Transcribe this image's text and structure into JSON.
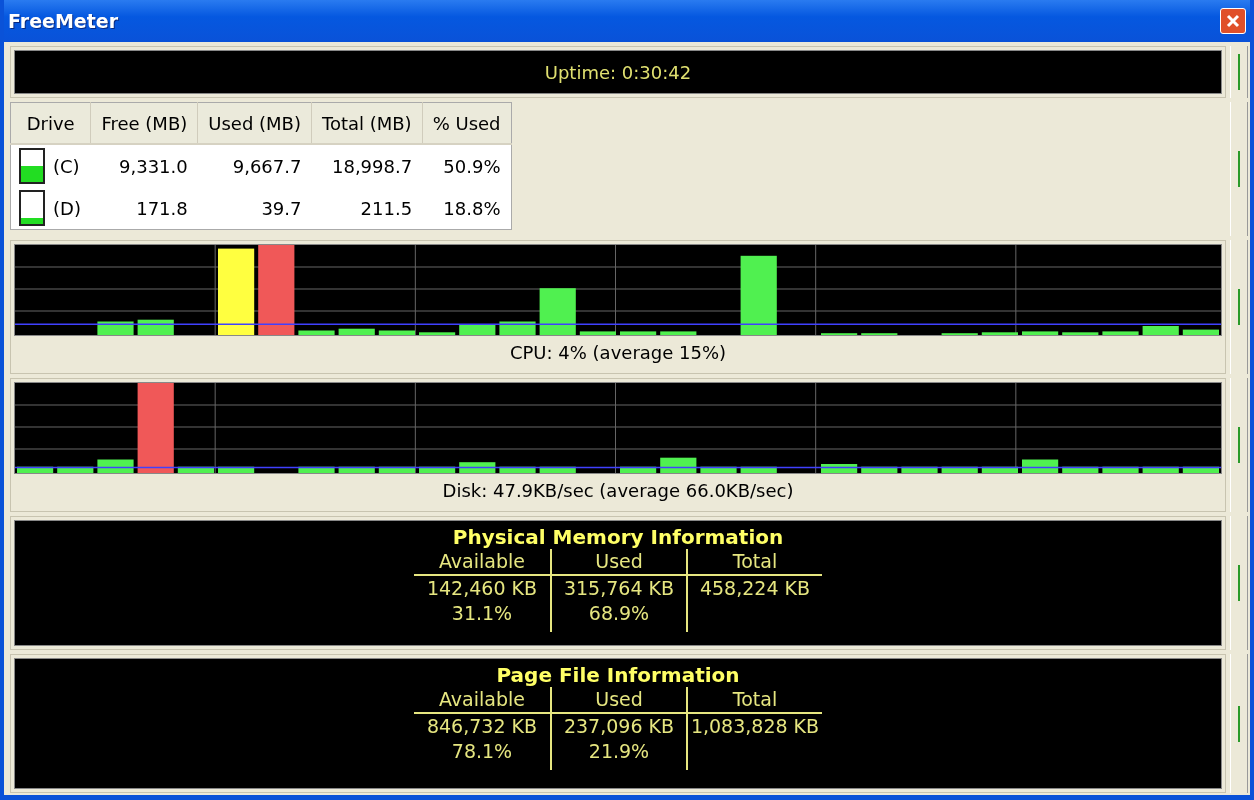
{
  "window": {
    "title": "FreeMeter"
  },
  "uptime": "Uptime: 0:30:42",
  "drives": {
    "columns": [
      "Drive",
      "Free (MB)",
      "Used (MB)",
      "Total (MB)",
      "% Used"
    ],
    "rows": [
      {
        "drive": "(C)",
        "free": "9,331.0",
        "used": "9,667.7",
        "total": "18,998.7",
        "percent_used": "50.9%",
        "level": 0.509
      },
      {
        "drive": "(D)",
        "free": "171.8",
        "used": "39.7",
        "total": "211.5",
        "percent_used": "18.8%",
        "level": 0.188
      }
    ]
  },
  "cpu": {
    "caption": "CPU: 4% (average 15%)"
  },
  "disk": {
    "caption": "Disk: 47.9KB/sec (average 66.0KB/sec)"
  },
  "physical_memory": {
    "title": "Physical Memory Information",
    "columns": [
      "Available",
      "Used",
      "Total"
    ],
    "cells": [
      {
        "amount": "142,460 KB",
        "percent": "31.1%"
      },
      {
        "amount": "315,764 KB",
        "percent": "68.9%"
      },
      {
        "amount": "458,224 KB"
      }
    ]
  },
  "page_file": {
    "title": "Page File Information",
    "columns": [
      "Available",
      "Used",
      "Total"
    ],
    "cells": [
      {
        "amount": "846,732 KB",
        "percent": "78.1%"
      },
      {
        "amount": "237,096 KB",
        "percent": "21.9%"
      },
      {
        "amount": "1,083,828 KB"
      }
    ]
  }
}
